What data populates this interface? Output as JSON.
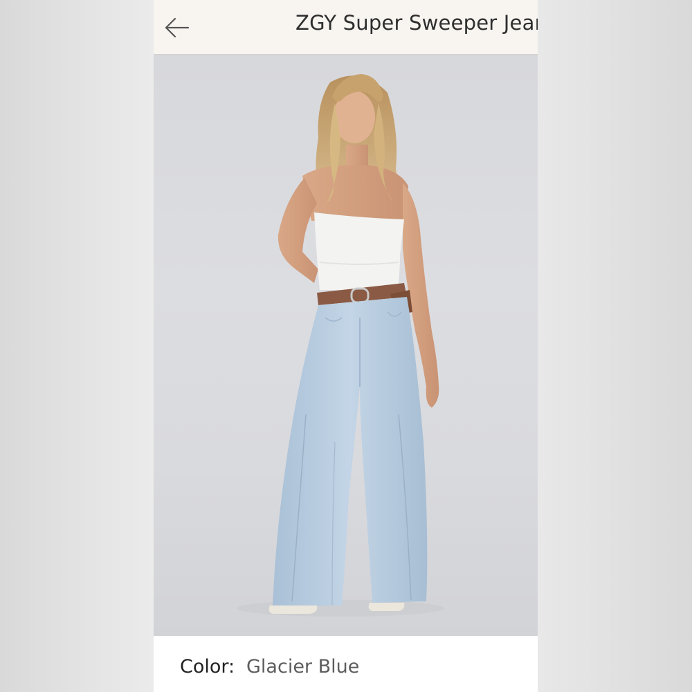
{
  "header": {
    "title": "ZGY Super Sweeper Jean",
    "back_icon": "arrow-left-icon"
  },
  "product_image": {
    "subject": "model-photo"
  },
  "details": {
    "color_label": "Color:",
    "color_value": "Glacier Blue"
  },
  "colors": {
    "header_bg": "#f8f5f1",
    "photo_bg": "#dadbdf",
    "denim": "#b8cde0",
    "top": "#f4f4f2",
    "belt": "#8a5a44"
  }
}
